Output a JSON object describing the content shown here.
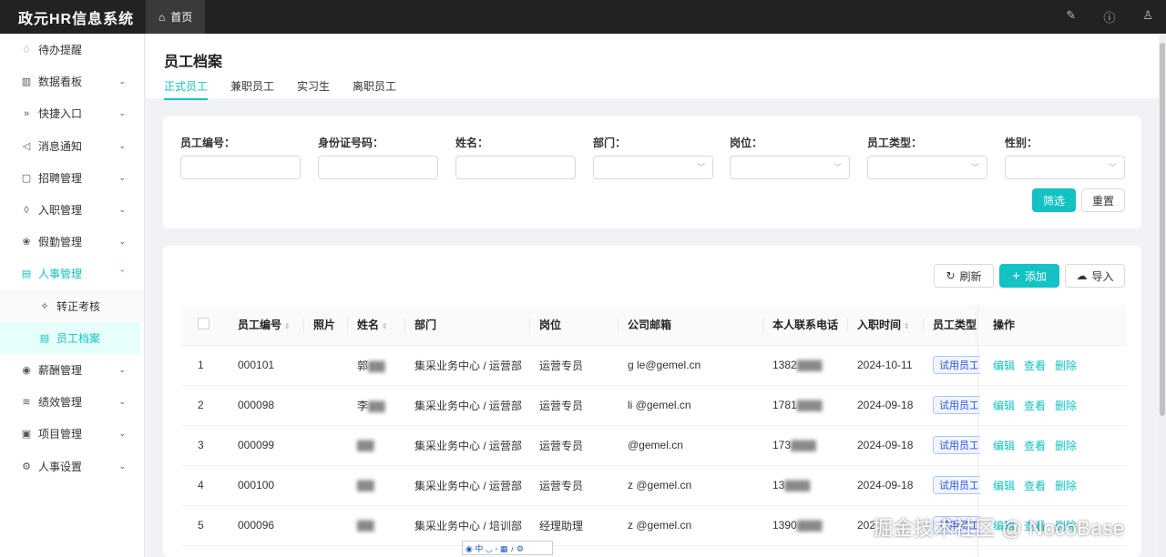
{
  "app": {
    "title": "政元HR信息系统",
    "home_tab": "首页"
  },
  "sidebar": {
    "items": [
      {
        "label": "待办提醒",
        "icon": "bulb-icon",
        "glyph": "♢",
        "chev": ""
      },
      {
        "label": "数据看板",
        "icon": "bar-chart-icon",
        "glyph": "▥",
        "chev": "⌄"
      },
      {
        "label": "快捷入口",
        "icon": "double-right-icon",
        "glyph": "»",
        "chev": "⌄"
      },
      {
        "label": "消息通知",
        "icon": "notification-icon",
        "glyph": "◁",
        "chev": "⌄"
      },
      {
        "label": "招聘管理",
        "icon": "file-icon",
        "glyph": "▢",
        "chev": "⌄"
      },
      {
        "label": "入职管理",
        "icon": "fire-icon",
        "glyph": "◊",
        "chev": "⌄"
      },
      {
        "label": "假勤管理",
        "icon": "dashboard-icon",
        "glyph": "❀",
        "chev": "⌄"
      },
      {
        "label": "人事管理",
        "icon": "profile-icon",
        "glyph": "▤",
        "chev": "⌃"
      }
    ],
    "sub_items": [
      {
        "label": "转正考核",
        "icon": "pushpin-icon",
        "glyph": "✧"
      },
      {
        "label": "员工档案",
        "icon": "profile-icon",
        "glyph": "▤"
      }
    ],
    "items_after": [
      {
        "label": "薪酬管理",
        "icon": "money-icon",
        "glyph": "◉",
        "chev": "⌄"
      },
      {
        "label": "绩效管理",
        "icon": "stock-icon",
        "glyph": "≋",
        "chev": "⌄"
      },
      {
        "label": "项目管理",
        "icon": "project-icon",
        "glyph": "▣",
        "chev": "⌄"
      },
      {
        "label": "人事设置",
        "icon": "setting-icon",
        "glyph": "⚙",
        "chev": "⌄"
      }
    ]
  },
  "page": {
    "title": "员工档案",
    "tabs": [
      "正式员工",
      "兼职员工",
      "实习生",
      "离职员工"
    ]
  },
  "filters": {
    "fields": [
      "员工编号：",
      "身份证号码：",
      "姓名：",
      "部门：",
      "岗位：",
      "员工类型：",
      "性别："
    ],
    "filter_btn": "筛选",
    "reset_btn": "重置"
  },
  "toolbar": {
    "refresh": "刷新",
    "add": "添加",
    "import": "导入"
  },
  "table": {
    "columns": [
      "员工编号",
      "照片",
      "姓名",
      "部门",
      "岗位",
      "公司邮箱",
      "本人联系电话",
      "入职时间",
      "员工类型",
      "操作"
    ],
    "rows": [
      {
        "no": "1",
        "id": "000101",
        "name": "郭",
        "dept": "集采业务中心 / 运营部",
        "post": "运营专员",
        "email": "g            le@gemel.cn",
        "phone": "1382",
        "date": "2024-10-11",
        "type": "试用员工"
      },
      {
        "no": "2",
        "id": "000098",
        "name": "李",
        "dept": "集采业务中心 / 运营部",
        "post": "运营专员",
        "email": "li            @gemel.cn",
        "phone": "1781",
        "date": "2024-09-18",
        "type": "试用员工"
      },
      {
        "no": "3",
        "id": "000099",
        "name": "",
        "dept": "集采业务中心 / 运营部",
        "post": "运营专员",
        "email": "             @gemel.cn",
        "phone": "173",
        "date": "2024-09-18",
        "type": "试用员工"
      },
      {
        "no": "4",
        "id": "000100",
        "name": "",
        "dept": "集采业务中心 / 运营部",
        "post": "运营专员",
        "email": "z                    @gemel.cn",
        "phone": "13",
        "date": "2024-09-18",
        "type": "试用员工"
      },
      {
        "no": "5",
        "id": "000096",
        "name": "",
        "dept": "集采业务中心 / 培训部",
        "post": "经理助理",
        "email": "z               @gemel.cn",
        "phone": "1390",
        "date": "202",
        "type": "试用员工"
      }
    ],
    "actions": [
      "编辑",
      "查看",
      "删除"
    ]
  },
  "watermark": "掘金技术社区 @ NocoBase",
  "accent": "#13c2c2"
}
